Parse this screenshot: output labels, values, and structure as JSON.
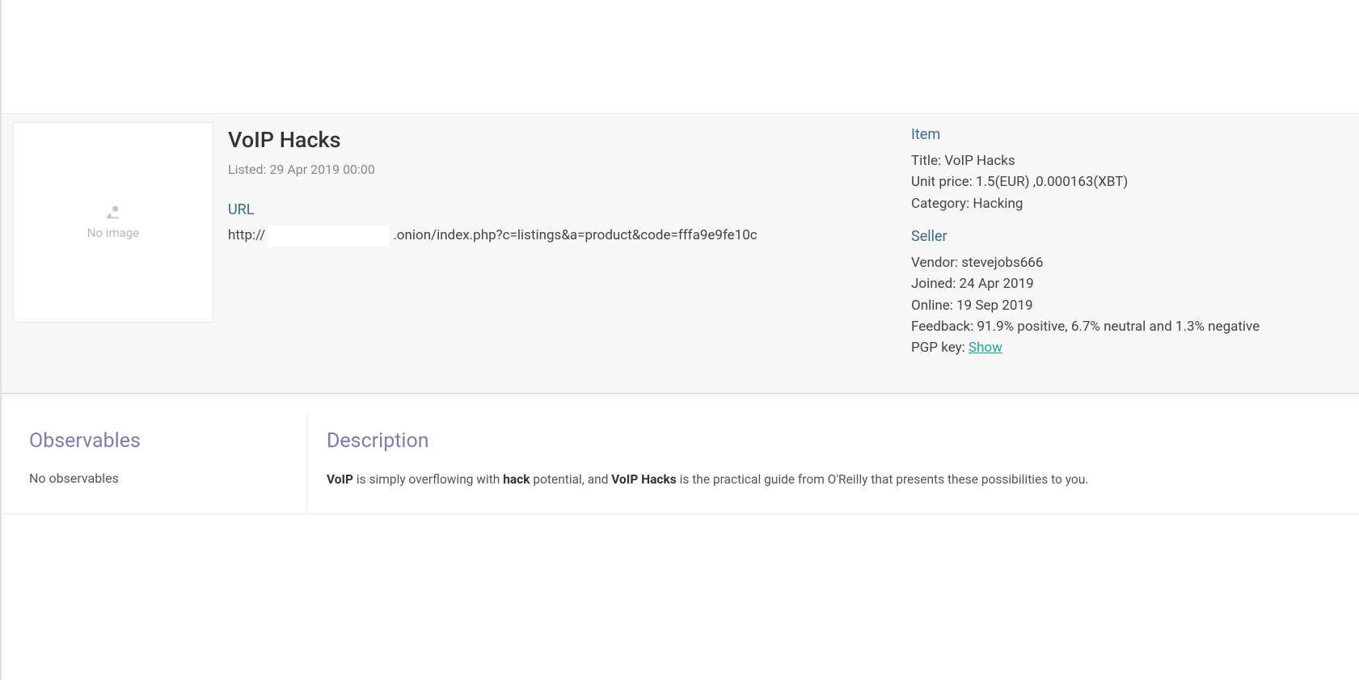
{
  "listing": {
    "title": "VoIP Hacks",
    "listed_label": "Listed:",
    "listed_value": "29 Apr 2019 00:00",
    "image_placeholder_text": "No image"
  },
  "url": {
    "label": "URL",
    "prefix": "http://",
    "suffix": ".onion/index.php?c=listings&a=product&code=fffa9e9fe10c"
  },
  "item": {
    "section_label": "Item",
    "title_label": "Title:",
    "title_value": "VoIP Hacks",
    "price_label": "Unit price:",
    "price_value": "1.5(EUR) ,0.000163(XBT)",
    "category_label": "Category:",
    "category_value": "Hacking"
  },
  "seller": {
    "section_label": "Seller",
    "vendor_label": "Vendor:",
    "vendor_value": "stevejobs666",
    "joined_label": "Joined:",
    "joined_value": "24 Apr 2019",
    "online_label": "Online:",
    "online_value": "19 Sep 2019",
    "feedback_label": "Feedback:",
    "feedback_value": "91.9% positive, 6.7% neutral and 1.3% negative",
    "pgp_label": "PGP key:",
    "pgp_link": "Show"
  },
  "observables": {
    "title": "Observables",
    "empty_text": "No observables"
  },
  "description": {
    "title": "Description",
    "bold1": "VoIP",
    "part1": " is simply overflowing with ",
    "bold2": "hack",
    "part2": " potential, and ",
    "bold3": "VoIP Hacks",
    "part3": " is the practical guide from O'Reilly that presents these possibilities to you."
  }
}
